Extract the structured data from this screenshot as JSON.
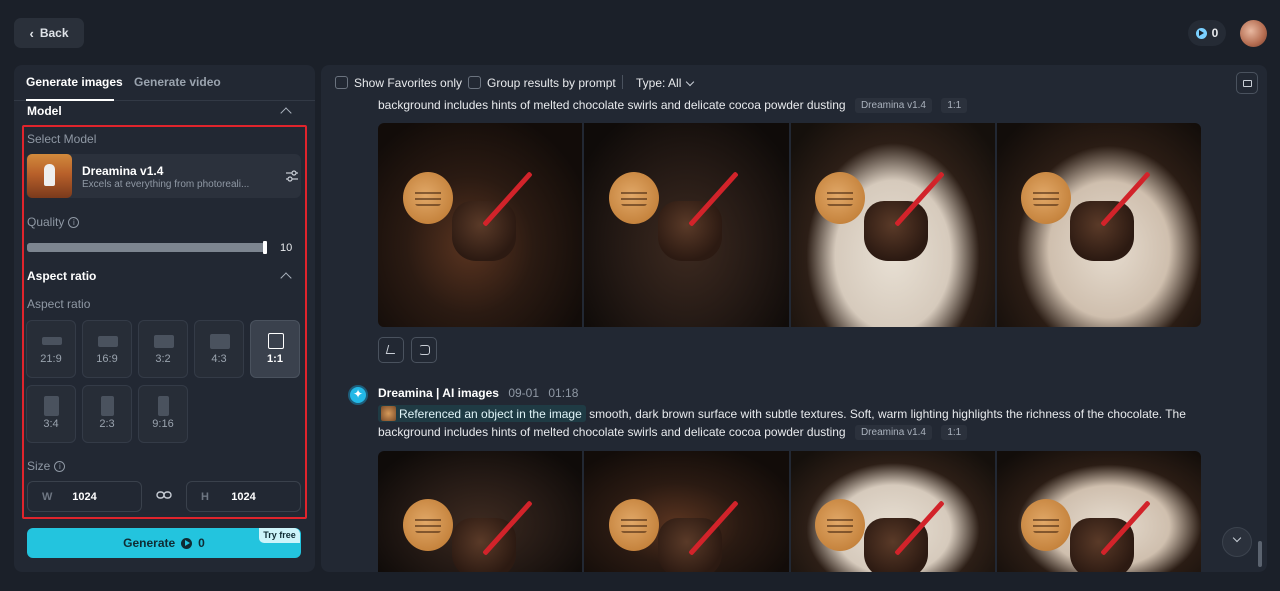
{
  "header": {
    "back_label": "Back",
    "credits": "0"
  },
  "left_panel": {
    "tabs": [
      {
        "label": "Generate images",
        "active": true
      },
      {
        "label": "Generate video",
        "active": false
      }
    ],
    "model_section_title": "Model",
    "select_model_label": "Select Model",
    "model": {
      "name": "Dreamina v1.4",
      "description": "Excels at everything from photoreali..."
    },
    "quality_label": "Quality",
    "quality_value": "10",
    "quality_level": 1.0,
    "aspect_section_title": "Aspect ratio",
    "aspect_label": "Aspect ratio",
    "aspect_ratios": [
      {
        "label": "21:9",
        "selected": false
      },
      {
        "label": "16:9",
        "selected": false
      },
      {
        "label": "3:2",
        "selected": false
      },
      {
        "label": "4:3",
        "selected": false
      },
      {
        "label": "1:1",
        "selected": true
      },
      {
        "label": "3:4",
        "selected": false
      },
      {
        "label": "2:3",
        "selected": false
      },
      {
        "label": "9:16",
        "selected": false
      }
    ],
    "size_label": "Size",
    "width_prefix": "W",
    "width_value": "1024",
    "height_prefix": "H",
    "height_value": "1024",
    "generate_label": "Generate",
    "generate_cost": "0",
    "try_free_badge": "Try free"
  },
  "right_panel": {
    "filters": {
      "favorites_label": "Show Favorites only",
      "group_label": "Group results by prompt",
      "type_label": "Type: All"
    },
    "result1": {
      "prompt_tail": "background includes hints of melted chocolate swirls and delicate cocoa powder dusting",
      "model_tag": "Dreamina v1.4",
      "ratio_tag": "1:1"
    },
    "result2": {
      "author": "Dreamina | AI images",
      "date": "09-01",
      "time": "01:18",
      "ref_chip": "Referenced an object in the image",
      "prompt_line1": "smooth, dark brown surface with subtle textures. Soft, warm lighting highlights the richness of the chocolate. The",
      "prompt_line2": "background includes hints of melted chocolate swirls and delicate cocoa powder dusting",
      "model_tag": "Dreamina v1.4",
      "ratio_tag": "1:1"
    }
  },
  "colors": {
    "accent": "#23c4de",
    "highlight_border": "#e0242c",
    "panel_bg": "#222833",
    "page_bg": "#1b2029"
  }
}
